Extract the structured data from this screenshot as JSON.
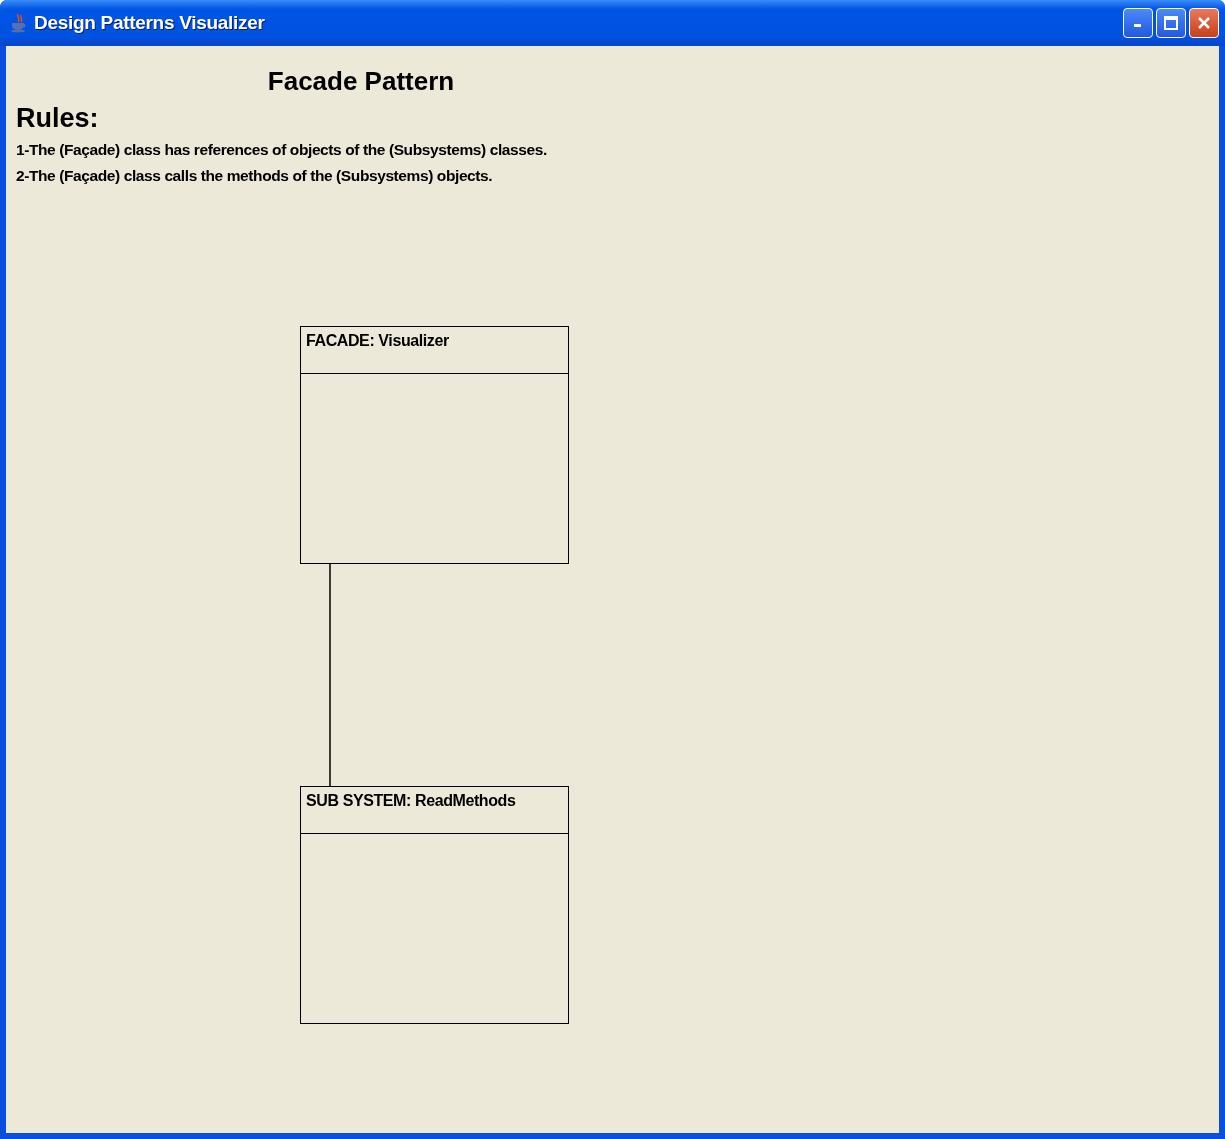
{
  "window": {
    "title": "Design Patterns Visualizer"
  },
  "heading": "Facade Pattern",
  "rules": {
    "title": "Rules:",
    "items": [
      "1-The (Façade) class has references of objects of the (Subsystems) classes.",
      "2-The (Façade) class calls the methods of the (Subsystems) objects."
    ]
  },
  "diagram": {
    "classes": [
      {
        "name": "FACADE: Visualizer"
      },
      {
        "name": "SUB SYSTEM: ReadMethods"
      }
    ]
  }
}
